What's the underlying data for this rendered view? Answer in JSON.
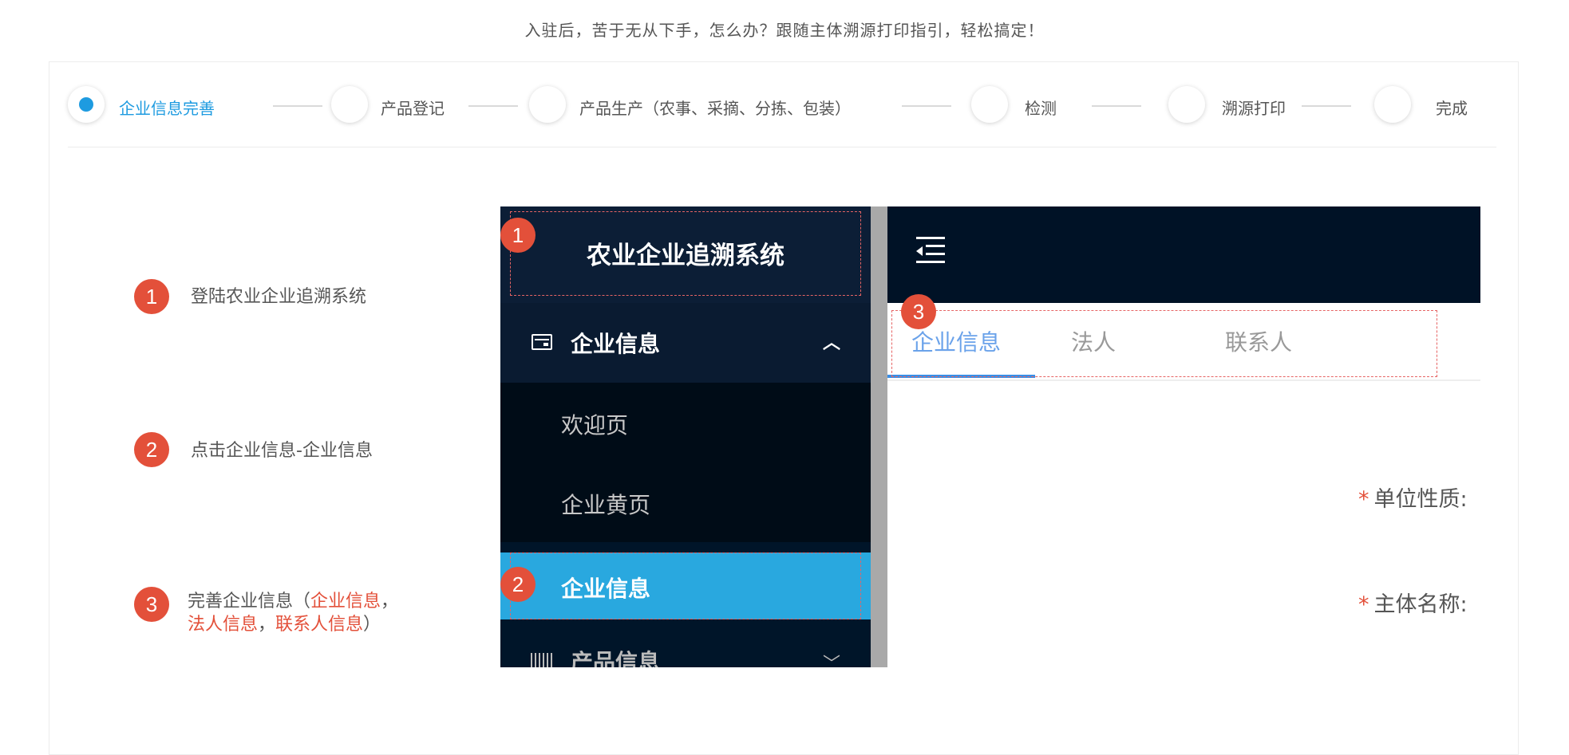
{
  "intro": "入驻后，苦于无从下手，怎么办？跟随主体溯源打印指引，轻松搞定！",
  "steps": [
    {
      "label": "企业信息完善",
      "active": true
    },
    {
      "label": "产品登记",
      "active": false
    },
    {
      "label": "产品生产（农事、采摘、分拣、包装）",
      "active": false
    },
    {
      "label": "检测",
      "active": false
    },
    {
      "label": "溯源打印",
      "active": false
    },
    {
      "label": "完成",
      "active": false
    }
  ],
  "instructions": [
    {
      "num": "1",
      "text": "登陆农业企业追溯系统"
    },
    {
      "num": "2",
      "text": "点击企业信息-企业信息"
    },
    {
      "num": "3",
      "text_prefix": "完善企业信息（",
      "hl1": "企业信息",
      "sep1": "，",
      "hl2": "法人信息",
      "sep2": "，",
      "hl3": "联系人信息",
      "suffix": "）"
    }
  ],
  "screenshot": {
    "brand": "农业企业追溯系统",
    "menu_group": {
      "label": "企业信息",
      "icon": "card-icon",
      "arrow": "^"
    },
    "submenu": [
      "欢迎页",
      "企业黄页",
      "企业信息"
    ],
    "next_group": {
      "label": "产品信息",
      "icon": "barcode-icon",
      "arrow": "v"
    },
    "tabs": [
      "企业信息",
      "法人",
      "联系人"
    ],
    "fields": [
      {
        "required": "*",
        "label": "单位性质:"
      },
      {
        "required": "*",
        "label": "主体名称:"
      }
    ],
    "markers": [
      "1",
      "2",
      "3"
    ]
  },
  "colors": {
    "accent": "#1e9be0",
    "badge": "#e3503a",
    "sidebar": "#001529",
    "active_menu": "#29a8df"
  }
}
